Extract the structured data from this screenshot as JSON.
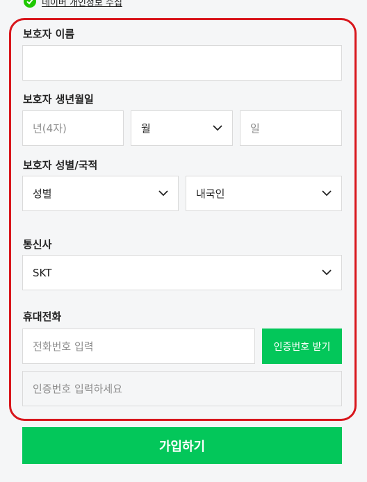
{
  "top_consent": {
    "label": "네이버 개인정보 수집"
  },
  "guardian_name": {
    "label": "보호자 이름",
    "value": ""
  },
  "guardian_birth": {
    "label": "보호자 생년월일",
    "year_placeholder": "년(4자)",
    "month_value": "월",
    "day_placeholder": "일"
  },
  "guardian_gender_nationality": {
    "label": "보호자 성별/국적",
    "gender_value": "성별",
    "nationality_value": "내국인"
  },
  "carrier": {
    "label": "통신사",
    "value": "SKT"
  },
  "phone": {
    "label": "휴대전화",
    "number_placeholder": "전화번호 입력",
    "verify_button": "인증번호 받기",
    "code_placeholder": "인증번호 입력하세요"
  },
  "signup_button": "가입하기",
  "colors": {
    "accent_green": "#03c75a",
    "highlight_red": "#d8161c",
    "background": "#f5f6f7"
  }
}
